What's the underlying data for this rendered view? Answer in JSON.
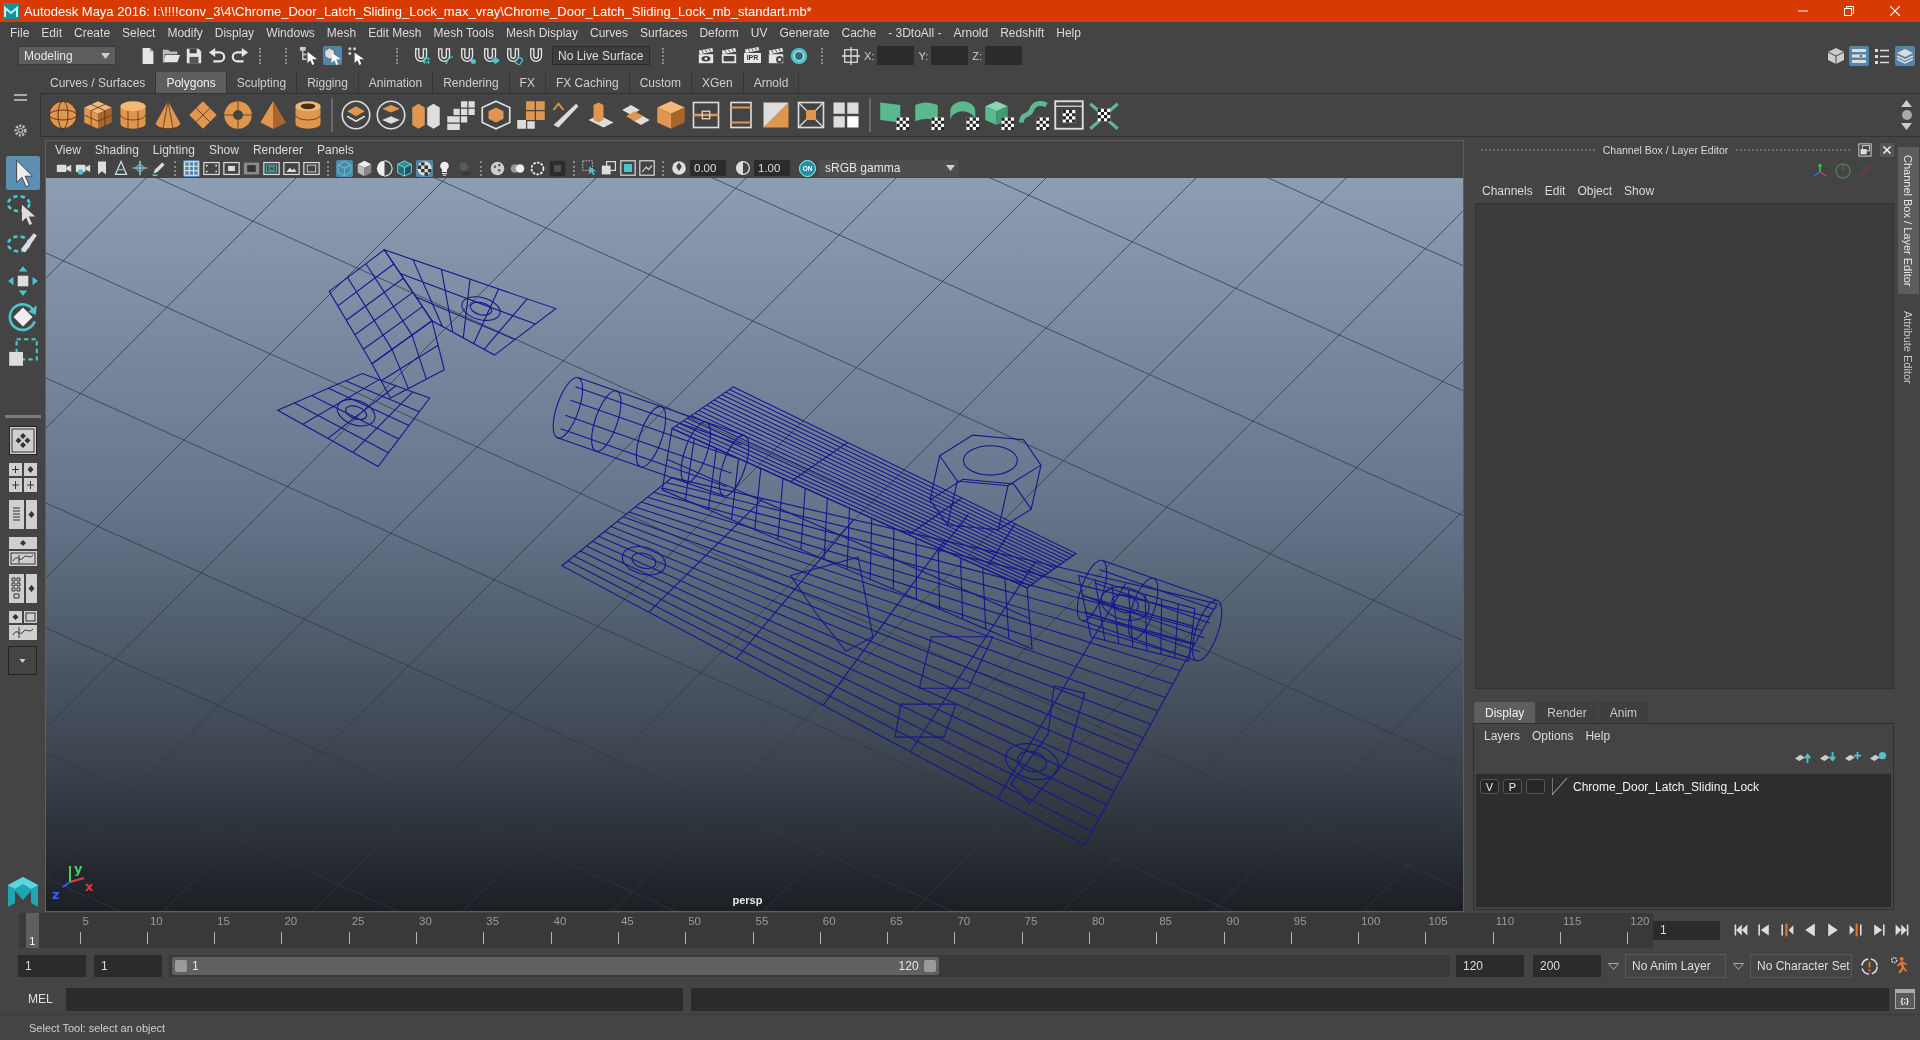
{
  "window": {
    "title": "Autodesk Maya 2016: I:\\!!!!conv_3\\4\\Chrome_Door_Latch_Sliding_Lock_max_vray\\Chrome_Door_Latch_Sliding_Lock_mb_standart.mb*"
  },
  "menu_bar": [
    "File",
    "Edit",
    "Create",
    "Select",
    "Modify",
    "Display",
    "Windows",
    "Mesh",
    "Edit Mesh",
    "Mesh Tools",
    "Mesh Display",
    "Curves",
    "Surfaces",
    "Deform",
    "UV",
    "Generate",
    "Cache",
    "- 3DtoAll -",
    "Arnold",
    "Redshift",
    "Help"
  ],
  "status_line": {
    "menu_set": "Modeling",
    "selection_modes": [
      {
        "selected": false
      },
      {
        "selected": true
      },
      {
        "selected": false
      }
    ],
    "live_surface": "No Live Surface",
    "ipr_label": "IPR",
    "coordinates": [
      {
        "label": "X:"
      },
      {
        "label": "Y:"
      },
      {
        "label": "Z:"
      }
    ],
    "panel_toggles": [
      {
        "on": false
      },
      {
        "on": true
      },
      {
        "on": false
      },
      {
        "on": true
      }
    ]
  },
  "shelf": {
    "tabs": [
      {
        "label": "Curves / Surfaces",
        "selected": false
      },
      {
        "label": "Polygons",
        "selected": true
      },
      {
        "label": "Sculpting",
        "selected": false
      },
      {
        "label": "Rigging",
        "selected": false
      },
      {
        "label": "Animation",
        "selected": false
      },
      {
        "label": "Rendering",
        "selected": false
      },
      {
        "label": "FX",
        "selected": false
      },
      {
        "label": "FX Caching",
        "selected": false
      },
      {
        "label": "Custom",
        "selected": false
      },
      {
        "label": "XGen",
        "selected": false
      },
      {
        "label": "Arnold",
        "selected": false
      }
    ]
  },
  "toolbox": {
    "tools": [
      {
        "selected": true
      },
      {
        "selected": false
      },
      {
        "selected": false
      },
      {
        "selected": false
      },
      {
        "selected": false
      },
      {
        "selected": false
      }
    ]
  },
  "viewport": {
    "menu": [
      "View",
      "Shading",
      "Lighting",
      "Show",
      "Renderer",
      "Panels"
    ],
    "toolbar": {
      "toggles": [
        {
          "on": true
        },
        {
          "on": false
        },
        {
          "on": false
        },
        {
          "on": false
        },
        {
          "on": false
        },
        {
          "on": false
        },
        {
          "on": false
        },
        {
          "on": true
        },
        {
          "on": false
        },
        {
          "on": false
        },
        {
          "on": false
        },
        {
          "on": true
        },
        {
          "on": false
        },
        {
          "on": false
        },
        {
          "on": false
        },
        {
          "on": false
        },
        {
          "on": false
        },
        {
          "on": false
        }
      ],
      "exposure": "0.00",
      "gamma": "1.00",
      "color_management": "ON",
      "view_transform": "sRGB gamma"
    },
    "camera": "persp",
    "axes": [
      {
        "label": "x",
        "color": "#e8383d"
      },
      {
        "label": "y",
        "color": "#3fd35a"
      },
      {
        "label": "z",
        "color": "#3a5cff"
      }
    ]
  },
  "channel_box": {
    "title": "Channel Box / Layer Editor",
    "menu": [
      "Channels",
      "Edit",
      "Object",
      "Show"
    ]
  },
  "layer_editor": {
    "tabs": [
      {
        "label": "Display",
        "selected": true
      },
      {
        "label": "Render",
        "selected": false
      },
      {
        "label": "Anim",
        "selected": false
      }
    ],
    "menu": [
      "Layers",
      "Options",
      "Help"
    ],
    "layers": [
      {
        "visibility": "V",
        "playback": "P",
        "name": "Chrome_Door_Latch_Sliding_Lock"
      }
    ]
  },
  "side_tabs": [
    {
      "label": "Channel Box / Layer Editor",
      "selected": true
    },
    {
      "label": "Attribute Editor",
      "selected": false
    }
  ],
  "time_slider": {
    "labels": [
      "5",
      "10",
      "15",
      "20",
      "25",
      "30",
      "35",
      "40",
      "45",
      "50",
      "55",
      "60",
      "65",
      "70",
      "75",
      "80",
      "85",
      "90",
      "95",
      "100",
      "105",
      "110",
      "115",
      "120"
    ],
    "playhead": {
      "label": "1",
      "level": 0
    },
    "current_frame": "1"
  },
  "range_slider": {
    "animation_start": "1",
    "playback_start": "1",
    "range_start": "1",
    "range_end": "120",
    "level": 0.6,
    "playback_end": "120",
    "animation_end": "200",
    "anim_layer": "No Anim Layer",
    "character_set": "No Character Set"
  },
  "command_line": {
    "language": "MEL",
    "script_editor": "{;}"
  },
  "help_line": "Select Tool: select an object"
}
